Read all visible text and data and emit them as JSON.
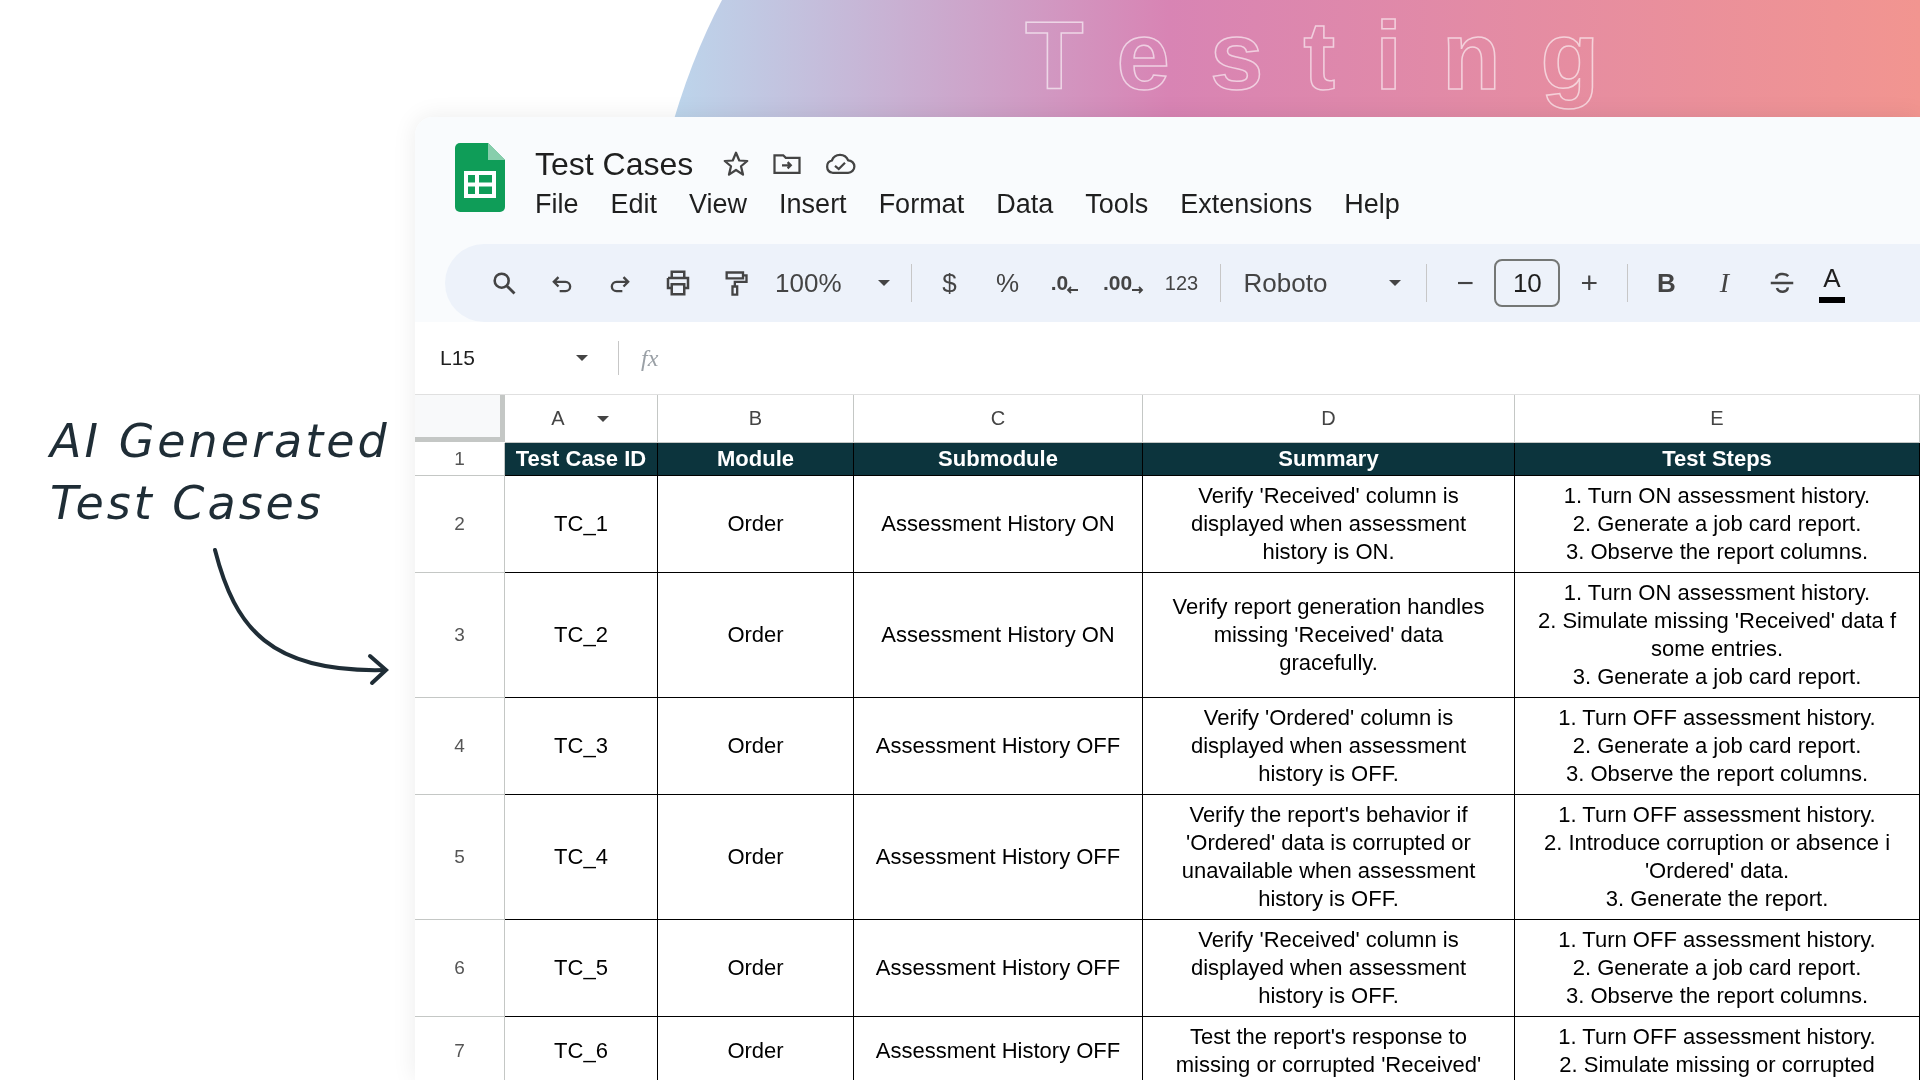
{
  "backdrop": {
    "headline": "Testing"
  },
  "annotation": {
    "lines": [
      "AI Generated",
      "Test Cases"
    ]
  },
  "window": {
    "title": "Test Cases"
  },
  "menu": [
    "File",
    "Edit",
    "View",
    "Insert",
    "Format",
    "Data",
    "Tools",
    "Extensions",
    "Help"
  ],
  "toolbar": {
    "zoom": "100%",
    "currency": "$",
    "percent": "%",
    "decrease_decimals": ".0",
    "increase_decimals": ".00",
    "number_format": "123",
    "font": "Roboto",
    "font_size_minus": "−",
    "font_size": "10",
    "font_size_plus": "+",
    "bold": "B",
    "italic": "I",
    "text_color": "A"
  },
  "formula_bar": {
    "cell_reference": "L15",
    "fx": "fx"
  },
  "sheet": {
    "columns": [
      {
        "letter": "A",
        "filter": true
      },
      {
        "letter": "B",
        "filter": false
      },
      {
        "letter": "C",
        "filter": false
      },
      {
        "letter": "D",
        "filter": false
      },
      {
        "letter": "E",
        "filter": false
      }
    ],
    "rows": [
      {
        "number": "1",
        "header": true,
        "cells": [
          "Test Case ID",
          "Module",
          "Submodule",
          "Summary",
          "Test Steps"
        ]
      },
      {
        "number": "2",
        "header": false,
        "cells": [
          "TC_1",
          "Order",
          "Assessment History ON",
          "Verify 'Received' column is\ndisplayed when assessment\nhistory is ON.",
          "1. Turn ON assessment history.\n2. Generate a job card report.\n3. Observe the report columns."
        ]
      },
      {
        "number": "3",
        "header": false,
        "cells": [
          "TC_2",
          "Order",
          "Assessment History ON",
          "Verify report generation handles\nmissing 'Received' data\ngracefully.",
          "1. Turn ON assessment history.\n2. Simulate missing 'Received' data f\nsome entries.\n3. Generate a job card report."
        ]
      },
      {
        "number": "4",
        "header": false,
        "cells": [
          "TC_3",
          "Order",
          "Assessment History OFF",
          "Verify 'Ordered' column is\ndisplayed when assessment\nhistory is OFF.",
          "1. Turn OFF assessment history.\n2. Generate a job card report.\n3. Observe the report columns."
        ]
      },
      {
        "number": "5",
        "header": false,
        "cells": [
          "TC_4",
          "Order",
          "Assessment History OFF",
          "Verify the report's behavior if\n'Ordered' data is corrupted or\nunavailable when assessment\nhistory is OFF.",
          "1. Turn OFF assessment history.\n2. Introduce corruption or absence i\n'Ordered' data.\n3. Generate the report."
        ]
      },
      {
        "number": "6",
        "header": false,
        "cells": [
          "TC_5",
          "Order",
          "Assessment History OFF",
          "Verify 'Received' column is\ndisplayed when assessment\nhistory is OFF.",
          "1. Turn OFF assessment history.\n2. Generate a job card report.\n3. Observe the report columns."
        ]
      },
      {
        "number": "7",
        "header": false,
        "cells": [
          "TC_6",
          "Order",
          "Assessment History OFF",
          "Test the report's response to\nmissing or corrupted 'Received'",
          "1. Turn OFF assessment history.\n2. Simulate missing or corrupted"
        ]
      }
    ]
  }
}
